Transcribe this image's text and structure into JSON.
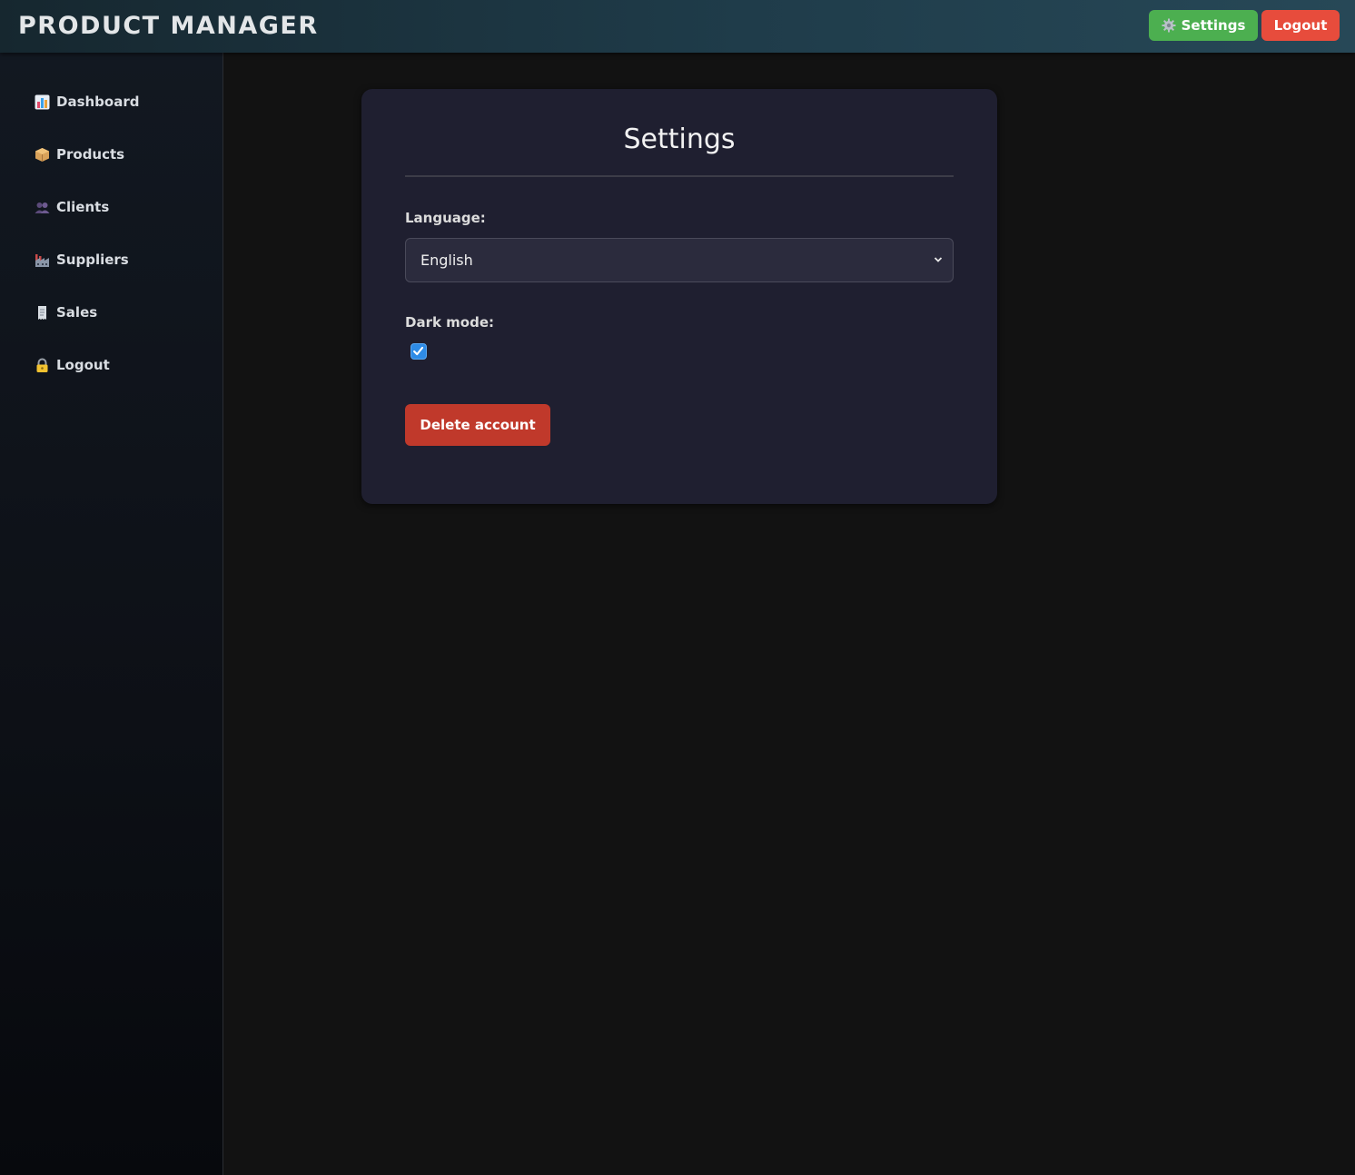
{
  "header": {
    "brand": "PRODUCT MANAGER",
    "settings_label": "Settings",
    "logout_label": "Logout",
    "settings_icon": "gear-icon",
    "colors": {
      "settings_button": "#4caf50",
      "logout_button": "#e74c3c"
    }
  },
  "sidebar": {
    "items": [
      {
        "label": "Dashboard",
        "icon": "bar-chart-icon"
      },
      {
        "label": "Products",
        "icon": "package-icon"
      },
      {
        "label": "Clients",
        "icon": "users-icon"
      },
      {
        "label": "Suppliers",
        "icon": "factory-icon"
      },
      {
        "label": "Sales",
        "icon": "receipt-icon"
      },
      {
        "label": "Logout",
        "icon": "lock-icon"
      }
    ]
  },
  "settings": {
    "title": "Settings",
    "language_label": "Language:",
    "language_value": "English",
    "dark_mode_label": "Dark mode:",
    "dark_mode_checked": true,
    "delete_label": "Delete account",
    "colors": {
      "delete_button": "#c0392b",
      "checkbox": "#2e8be6"
    }
  }
}
